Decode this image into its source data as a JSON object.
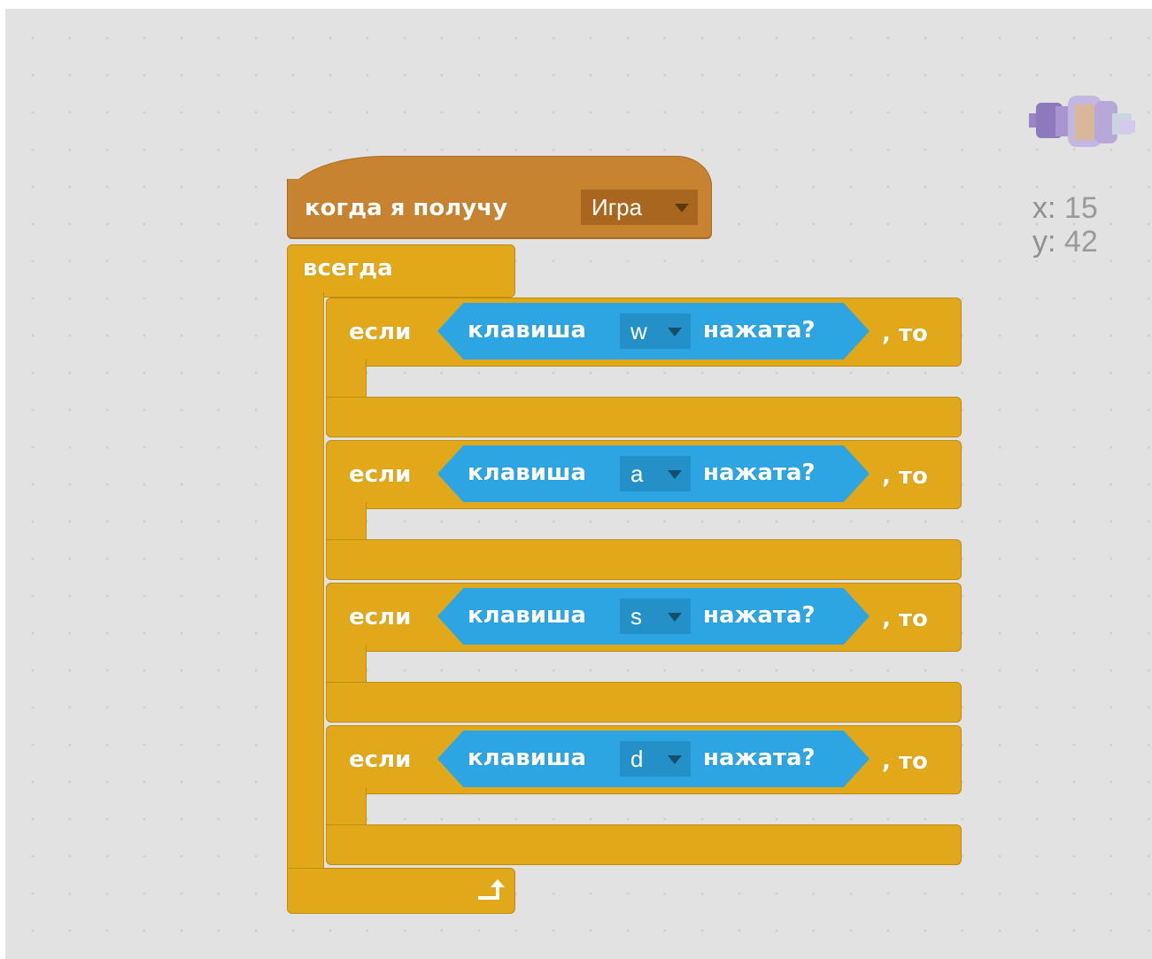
{
  "event_block": {
    "label": "когда я получу",
    "message": "Игра"
  },
  "forever_block": {
    "label": "всегда"
  },
  "if_blocks": [
    {
      "if_label": "если",
      "sensing_label": "клавиша",
      "key": "w",
      "pressed_label": "нажата?",
      "then_label": ", то"
    },
    {
      "if_label": "если",
      "sensing_label": "клавиша",
      "key": "a",
      "pressed_label": "нажата?",
      "then_label": ", то"
    },
    {
      "if_label": "если",
      "sensing_label": "клавиша",
      "key": "s",
      "pressed_label": "нажата?",
      "then_label": ", то"
    },
    {
      "if_label": "если",
      "sensing_label": "клавиша",
      "key": "d",
      "pressed_label": "нажата?",
      "then_label": ", то"
    }
  ],
  "sprite_info": {
    "x_label": "x:",
    "x_value": "15",
    "y_label": "y:",
    "y_value": "42"
  },
  "colors": {
    "events": "#c88330",
    "control": "#e1a91a",
    "sensing": "#2ca5e2",
    "workspace": "#e2e2e2"
  },
  "icons": {
    "loop": "loop-arrow-icon",
    "dropdown": "dropdown-arrow-icon"
  }
}
